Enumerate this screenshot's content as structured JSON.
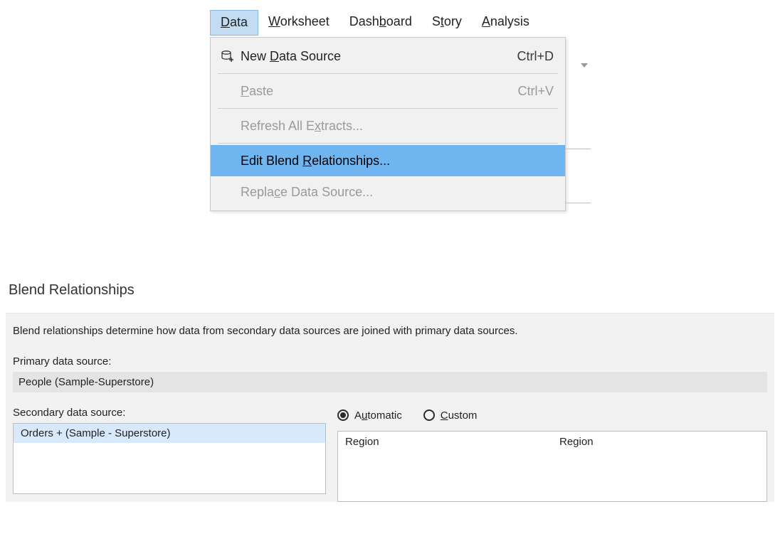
{
  "menubar": {
    "items": [
      {
        "pre": "",
        "u": "D",
        "post": "ata",
        "active": true
      },
      {
        "pre": "",
        "u": "W",
        "post": "orksheet",
        "active": false
      },
      {
        "pre": "Dash",
        "u": "b",
        "post": "oard",
        "active": false
      },
      {
        "pre": "S",
        "u": "t",
        "post": "ory",
        "active": false
      },
      {
        "pre": "",
        "u": "A",
        "post": "nalysis",
        "active": false
      }
    ]
  },
  "dropdown": {
    "items": [
      {
        "pre": "New ",
        "u": "D",
        "post": "ata Source",
        "shortcut": "Ctrl+D",
        "enabled": true,
        "has_icon": true
      },
      {
        "sep": true
      },
      {
        "pre": "",
        "u": "P",
        "post": "aste",
        "shortcut": "Ctrl+V",
        "enabled": false
      },
      {
        "sep": true
      },
      {
        "pre": "Refresh All E",
        "u": "x",
        "post": "tracts...",
        "shortcut": "",
        "enabled": false
      },
      {
        "sep": true
      },
      {
        "pre": "Edit Blend ",
        "u": "R",
        "post": "elationships...",
        "shortcut": "",
        "enabled": true,
        "highlight": true
      },
      {
        "pre": "Repla",
        "u": "c",
        "post": "e Data Source...",
        "shortcut": "",
        "enabled": false
      }
    ]
  },
  "dialog": {
    "title": "Blend Relationships",
    "description": "Blend relationships determine how data from secondary data sources are joined with primary data sources.",
    "primary_label": "Primary data source:",
    "primary_value": "People (Sample-Superstore)",
    "secondary_label": "Secondary data source:",
    "secondary_items": [
      "Orders + (Sample - Superstore)"
    ],
    "radio_auto_pre": "A",
    "radio_auto_u": "u",
    "radio_auto_post": "tomatic",
    "radio_custom_pre": "",
    "radio_custom_u": "C",
    "radio_custom_post": "ustom",
    "link_left": "Region",
    "link_right": "Region"
  }
}
